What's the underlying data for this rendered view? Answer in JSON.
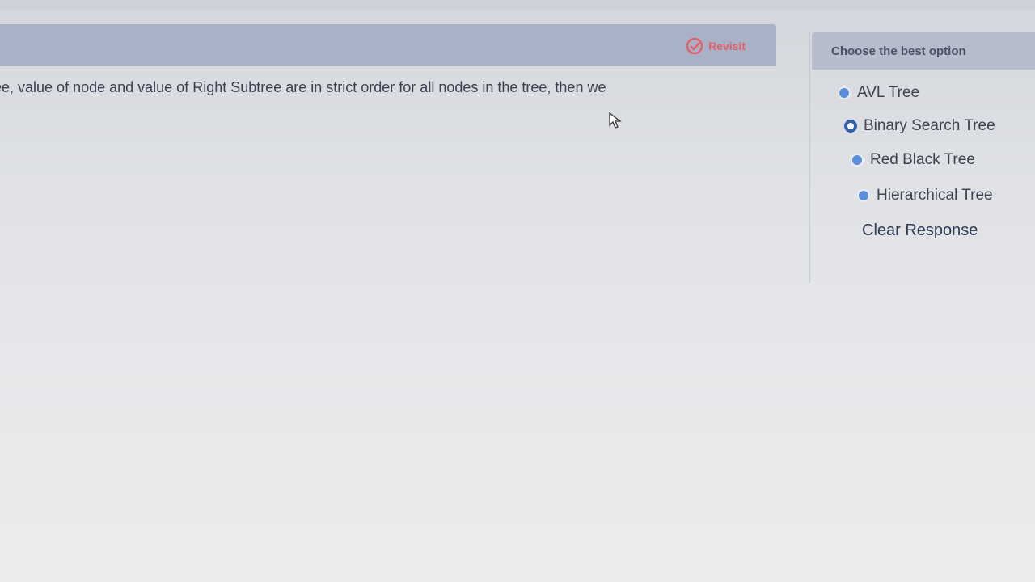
{
  "question": {
    "revisit_label": "Revisit",
    "text": "ee, value of node and value of Right Subtree are in strict order for all nodes in the tree, then we"
  },
  "options_panel": {
    "header": "Choose the best option",
    "options": [
      {
        "label": "AVL Tree",
        "selected": false
      },
      {
        "label": "Binary Search Tree",
        "selected": true
      },
      {
        "label": "Red Black Tree",
        "selected": false
      },
      {
        "label": "Hierarchical Tree",
        "selected": false
      }
    ],
    "clear_label": "Clear Response"
  },
  "colors": {
    "header_bar": "#a9b1c6",
    "revisit_accent": "#e4606a",
    "radio_fill": "#5a8ed8"
  }
}
